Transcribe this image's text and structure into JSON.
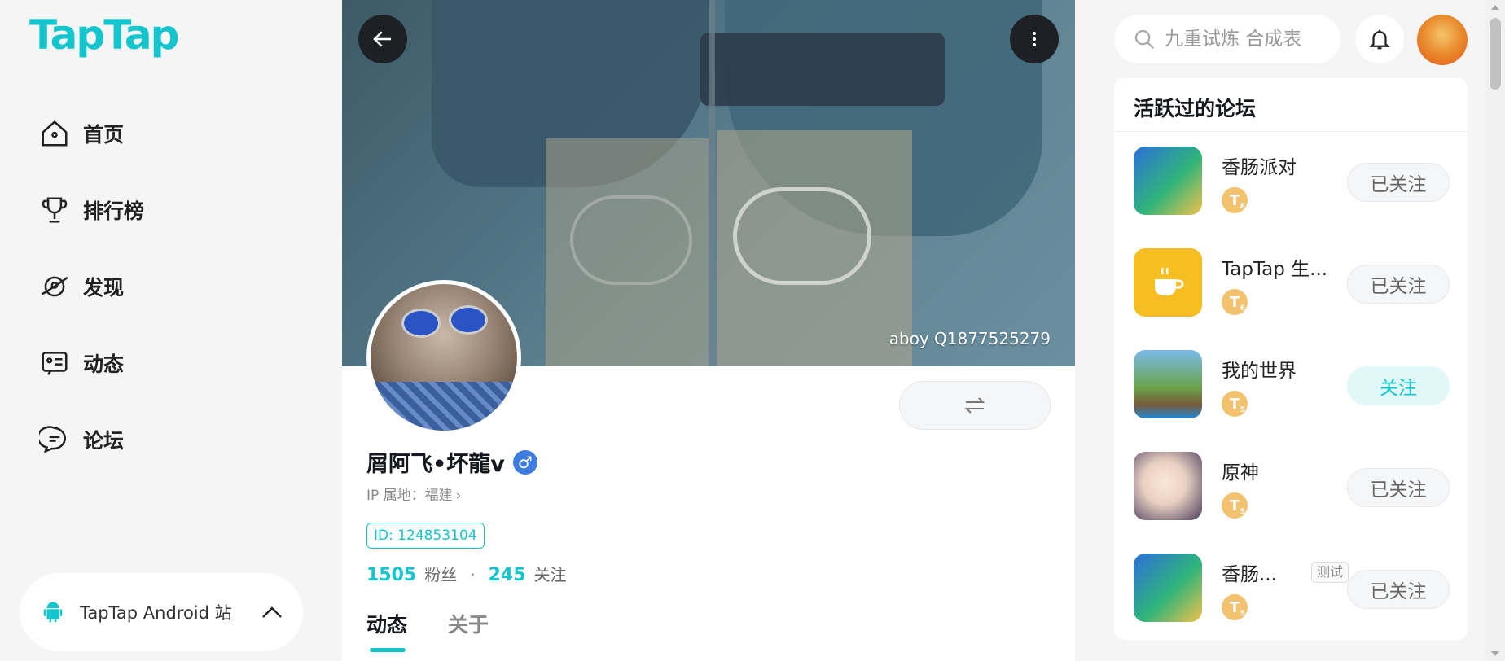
{
  "brand": {
    "logo_text": "TapTap",
    "accent": "#15c5ce"
  },
  "nav": [
    {
      "label": "首页",
      "icon": "home-icon"
    },
    {
      "label": "排行榜",
      "icon": "trophy-icon"
    },
    {
      "label": "发现",
      "icon": "planet-icon"
    },
    {
      "label": "动态",
      "icon": "feed-icon"
    },
    {
      "label": "论坛",
      "icon": "forum-icon"
    }
  ],
  "android_bar": {
    "label": "TapTap Android 站",
    "icon": "android-icon"
  },
  "profile": {
    "banner_watermark": "aboy Q1877525279",
    "name": "屑阿飞•坏龍v",
    "gender_symbol": "♂",
    "ip_label": "IP 属地：福建",
    "id_label": "ID: 124853104",
    "fans_count": "1505",
    "fans_label": "粉丝",
    "following_count": "245",
    "following_label": "关注",
    "tabs": [
      "动态",
      "关于"
    ]
  },
  "search": {
    "placeholder": "九重试炼 合成表"
  },
  "forums": {
    "title": "活跃过的论坛",
    "items": [
      {
        "name": "香肠派对",
        "level": "8",
        "button": "已关注",
        "followed": true
      },
      {
        "name": "TapTap 生...",
        "level": "6",
        "button": "已关注",
        "followed": true
      },
      {
        "name": "我的世界",
        "level": "5",
        "button": "关注",
        "followed": false
      },
      {
        "name": "原神",
        "level": "5",
        "button": "已关注",
        "followed": true
      },
      {
        "name": "香肠...",
        "level": "5",
        "button": "已关注",
        "followed": true,
        "tag": "测试"
      }
    ]
  }
}
